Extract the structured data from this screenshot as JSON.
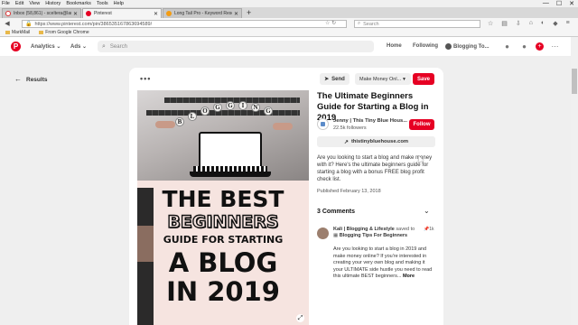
{
  "menubar": {
    "items": [
      "File",
      "Edit",
      "View",
      "History",
      "Bookmarks",
      "Tools",
      "Help"
    ],
    "controls": [
      "—",
      "☐",
      "✕"
    ]
  },
  "tabs": [
    {
      "label": "Inbox (58,861) - sceltera@lam...",
      "icon": "gmail-icon"
    },
    {
      "label": "Pinterest",
      "icon": "pinterest-icon"
    },
    {
      "label": "Long Tail Pro - Keyword Resear...",
      "icon": "longtailpro-icon"
    }
  ],
  "newtab_label": "+",
  "navbar": {
    "url": "https://www.pinterest.com/pin/386535167863694589/",
    "search_placeholder": "Search"
  },
  "bookmarks": [
    "MarkMail",
    "From Google Chrome"
  ],
  "pinterest_header": {
    "logo": "P",
    "analytics": "Analytics",
    "ads": "Ads",
    "search_placeholder": "Search",
    "home": "Home",
    "following": "Following",
    "profile": "Blogging To..."
  },
  "results_label": "Results",
  "pin": {
    "more": "•••",
    "send": "Send",
    "board": "Make Money Onl...",
    "save": "Save",
    "image_text": {
      "top_word": "BLOGGING",
      "line1": "THE BEST",
      "line2": "BEGINNERS",
      "line3": "GUIDE FOR STARTING",
      "line4": "A BLOG",
      "line5": "IN 2019"
    },
    "title": "The Ultimate Beginners Guide for Starting a Blog in 2019",
    "author": "Jenny | This Tiny Blue Hous...",
    "followers": "22.5k followers",
    "follow": "Follow",
    "link": "thistinybluehouse.com",
    "description": "Are you looking to start a blog and make money with it? Here's the ultimate beginners guide for starting a blog with a bonus FREE blog profit check list.",
    "published": "Published February 13, 2018",
    "comments_header": "3 Comments",
    "comment": {
      "user": "Kali | Blogging & Lifestyle",
      "saved_to": "saved to",
      "board": "Blogging Tips For Beginners",
      "likes": "1k",
      "body": "Are you looking to start a blog in 2019 and make money online? If you're interested in creating your very own blog and making it your ULTIMATE side hustle you need to read this ultimate BEST beginners...",
      "more": "More"
    }
  },
  "colors": {
    "pinterest_red": "#e60023",
    "pin_bg": "#f6e4e0"
  }
}
